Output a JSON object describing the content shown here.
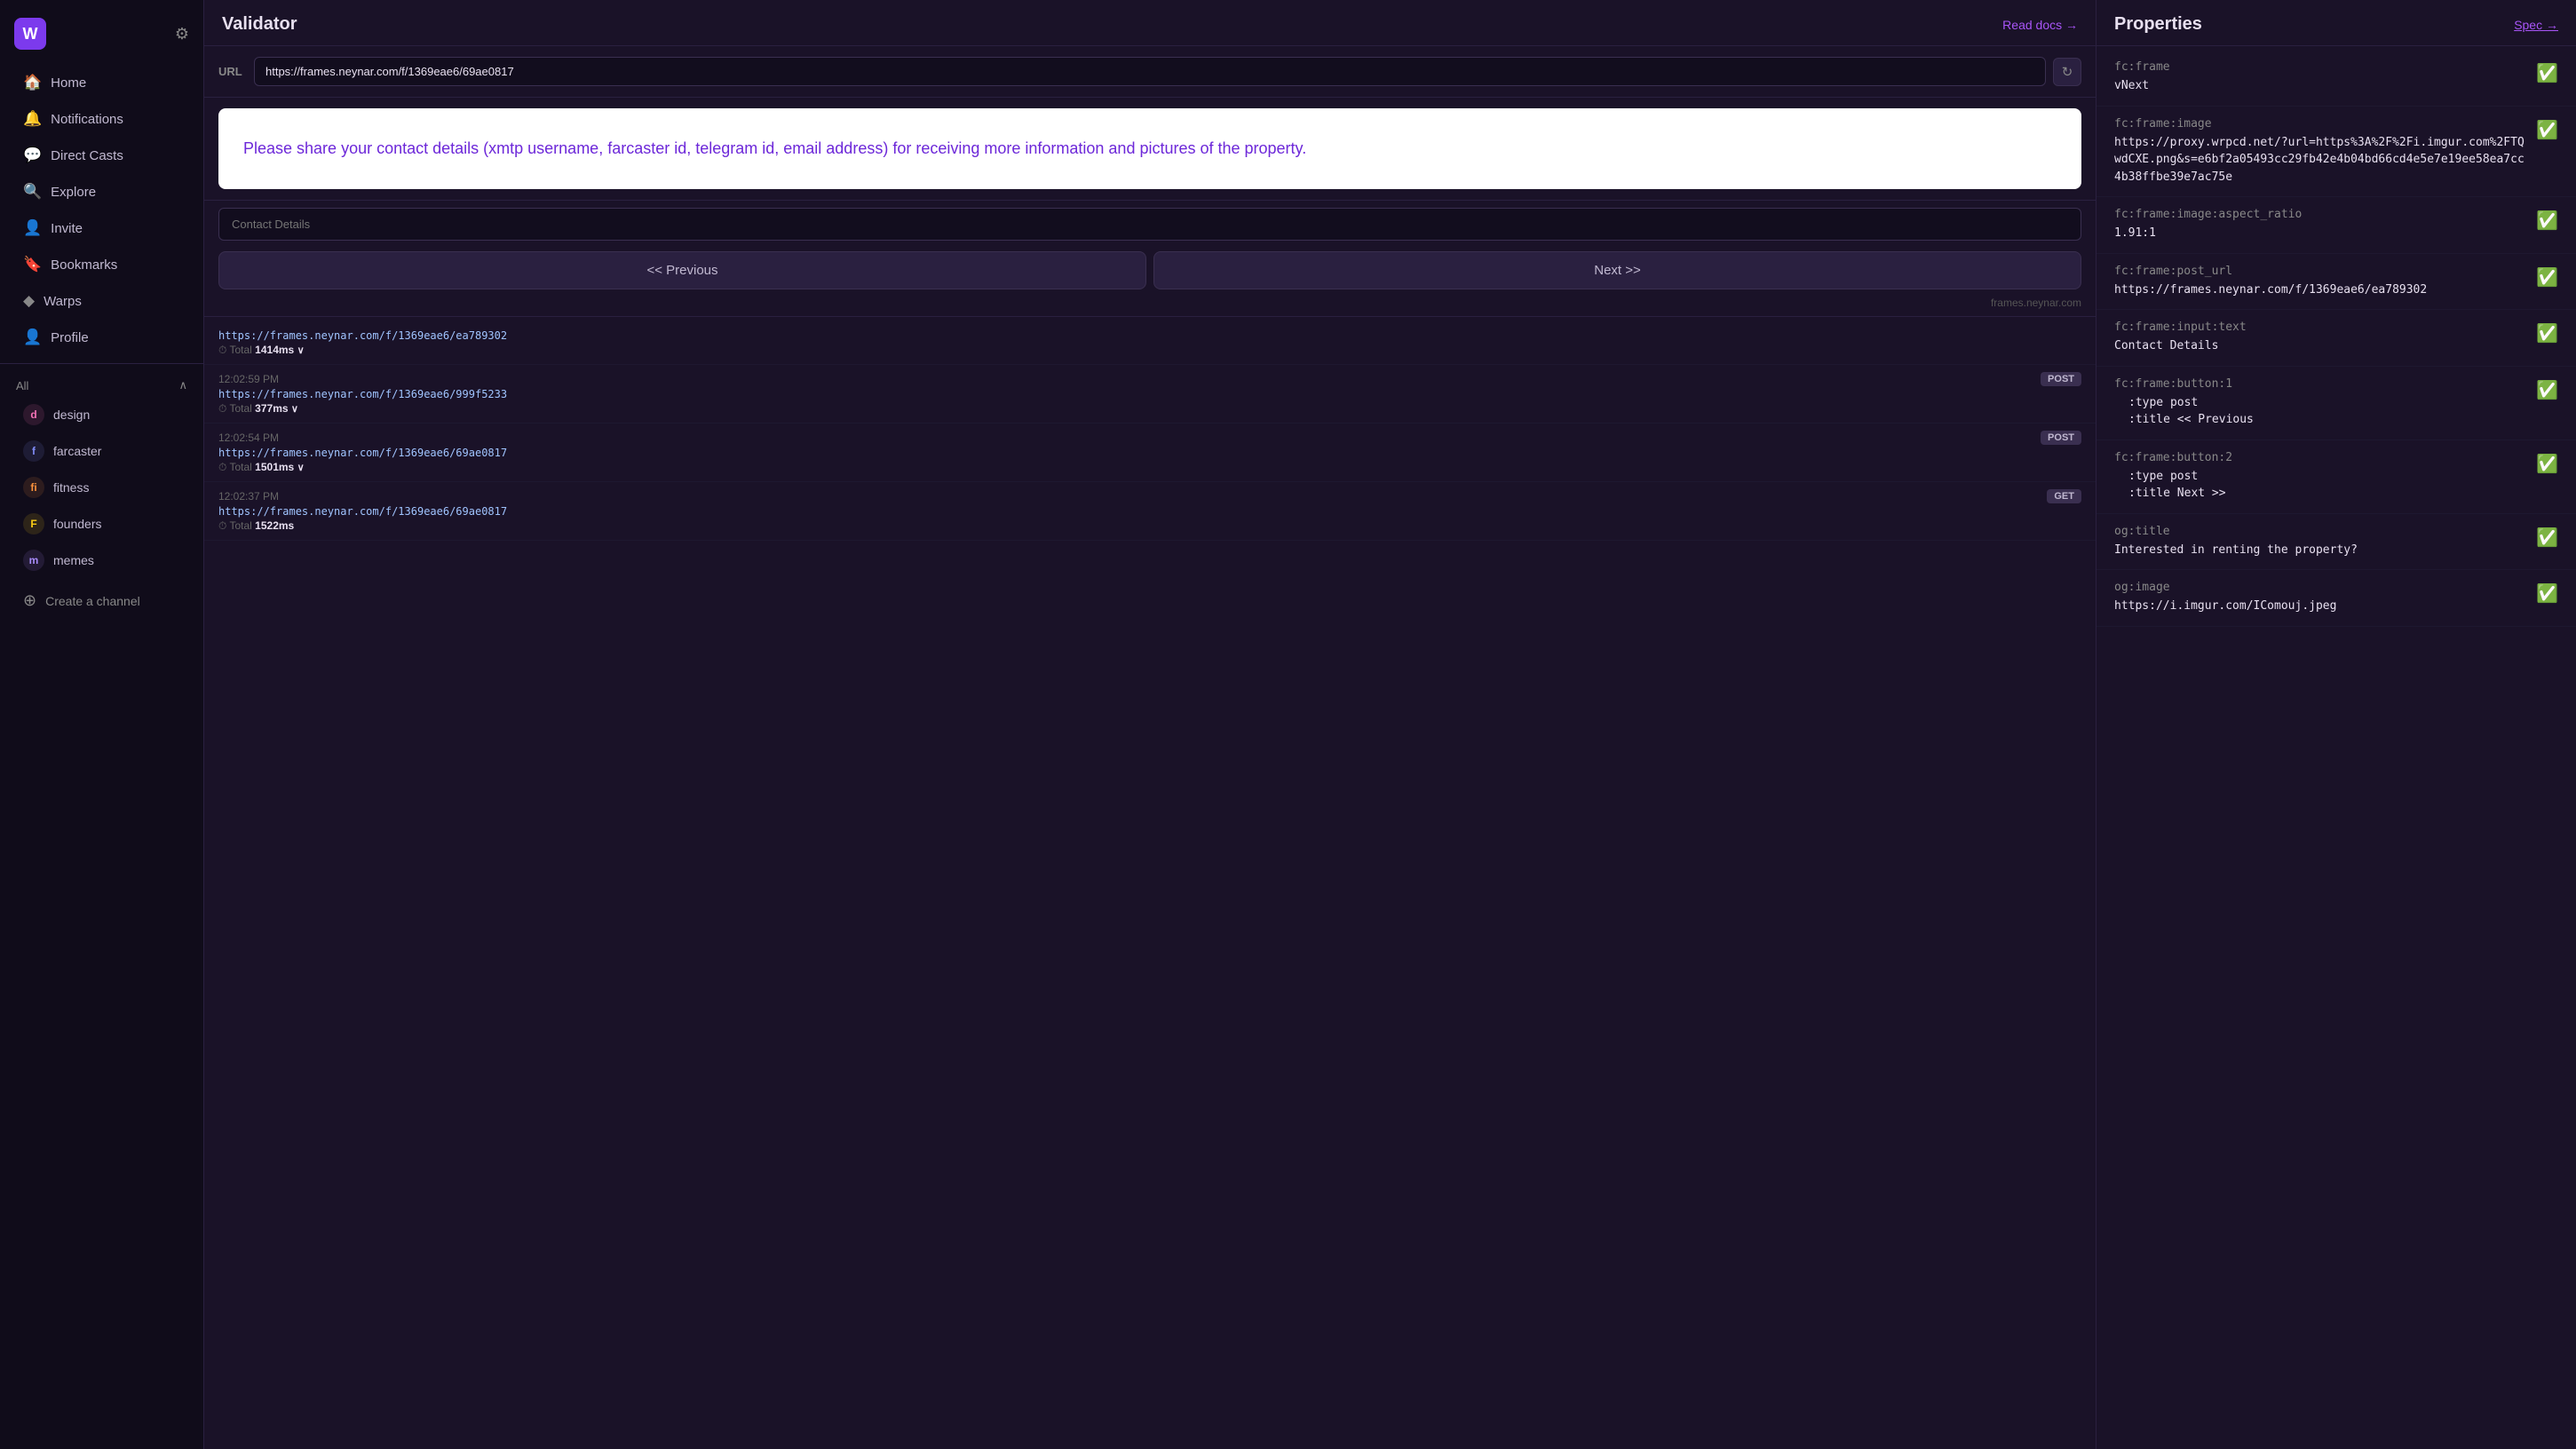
{
  "sidebar": {
    "logo_letter": "W",
    "nav_items": [
      {
        "id": "home",
        "label": "Home",
        "icon": "🏠"
      },
      {
        "id": "notifications",
        "label": "Notifications",
        "icon": "🔔"
      },
      {
        "id": "direct-casts",
        "label": "Direct Casts",
        "icon": "💬"
      },
      {
        "id": "explore",
        "label": "Explore",
        "icon": "🔍"
      },
      {
        "id": "invite",
        "label": "Invite",
        "icon": "👤"
      },
      {
        "id": "bookmarks",
        "label": "Bookmarks",
        "icon": "🔖"
      },
      {
        "id": "warps",
        "label": "Warps",
        "icon": "◆"
      },
      {
        "id": "profile",
        "label": "Profile",
        "icon": "👤"
      }
    ],
    "section_label": "All",
    "channels": [
      {
        "id": "design",
        "label": "design",
        "color": "#f472b6",
        "letter": "d"
      },
      {
        "id": "farcaster",
        "label": "farcaster",
        "color": "#818cf8",
        "letter": "f"
      },
      {
        "id": "fitness",
        "label": "fitness",
        "color": "#fb923c",
        "letter": "fi"
      },
      {
        "id": "founders",
        "label": "founders",
        "color": "#facc15",
        "letter": "F"
      },
      {
        "id": "memes",
        "label": "memes",
        "color": "#a78bfa",
        "letter": "m"
      }
    ],
    "create_channel_label": "Create a channel"
  },
  "validator": {
    "title": "Validator",
    "read_docs_label": "Read docs →",
    "url_label": "URL",
    "url_value": "https://frames.neynar.com/f/1369eae6/69ae0817",
    "frame_text": "Please share your contact details (xmtp username, farcaster id, telegram id, email address) for receiving more information and pictures of the property.",
    "input_placeholder": "Contact Details",
    "btn_previous": "<< Previous",
    "btn_next": "Next >>",
    "frame_source": "frames.neynar.com",
    "logs": [
      {
        "time": "",
        "badge": "",
        "url": "https://frames.neynar.com/f/1369eae6/ea789302",
        "total": "1414ms",
        "has_expand": true
      },
      {
        "time": "12:02:59 PM",
        "badge": "POST",
        "url": "https://frames.neynar.com/f/1369eae6/999f5233",
        "total": "377ms",
        "has_expand": true
      },
      {
        "time": "12:02:54 PM",
        "badge": "POST",
        "url": "https://frames.neynar.com/f/1369eae6/69ae0817",
        "total": "1501ms",
        "has_expand": true
      },
      {
        "time": "12:02:37 PM",
        "badge": "GET",
        "url": "https://frames.neynar.com/f/1369eae6/69ae0817",
        "total": "1522ms",
        "has_expand": false
      }
    ]
  },
  "properties": {
    "title": "Properties",
    "spec_label": "Spec →",
    "items": [
      {
        "key": "fc:frame",
        "value": "vNext",
        "valid": true
      },
      {
        "key": "fc:frame:image",
        "value": "https://proxy.wrpcd.net/?url=https%3A%2F%2Fi.imgur.com%2FTQwdCXE.png&s=e6bf2a05493cc29fb42e4b04bd66cd4e5e7e19ee58ea7cc4b38ffbe39e7ac75e",
        "valid": true
      },
      {
        "key": "fc:frame:image:aspect_ratio",
        "value": "1.91:1",
        "valid": true
      },
      {
        "key": "fc:frame:post_url",
        "value": "https://frames.neynar.com/f/1369eae6/ea789302",
        "valid": true
      },
      {
        "key": "fc:frame:input:text",
        "value": "Contact Details",
        "valid": true
      },
      {
        "key": "fc:frame:button:1",
        "value_lines": [
          "  :type post",
          "  :title << Previous"
        ],
        "valid": true
      },
      {
        "key": "fc:frame:button:2",
        "value_lines": [
          "  :type post",
          "  :title Next >>"
        ],
        "valid": true
      },
      {
        "key": "og:title",
        "value": "Interested in renting the property?",
        "valid": true
      },
      {
        "key": "og:image",
        "value": "https://i.imgur.com/IComouj.jpeg",
        "valid": true
      }
    ]
  }
}
